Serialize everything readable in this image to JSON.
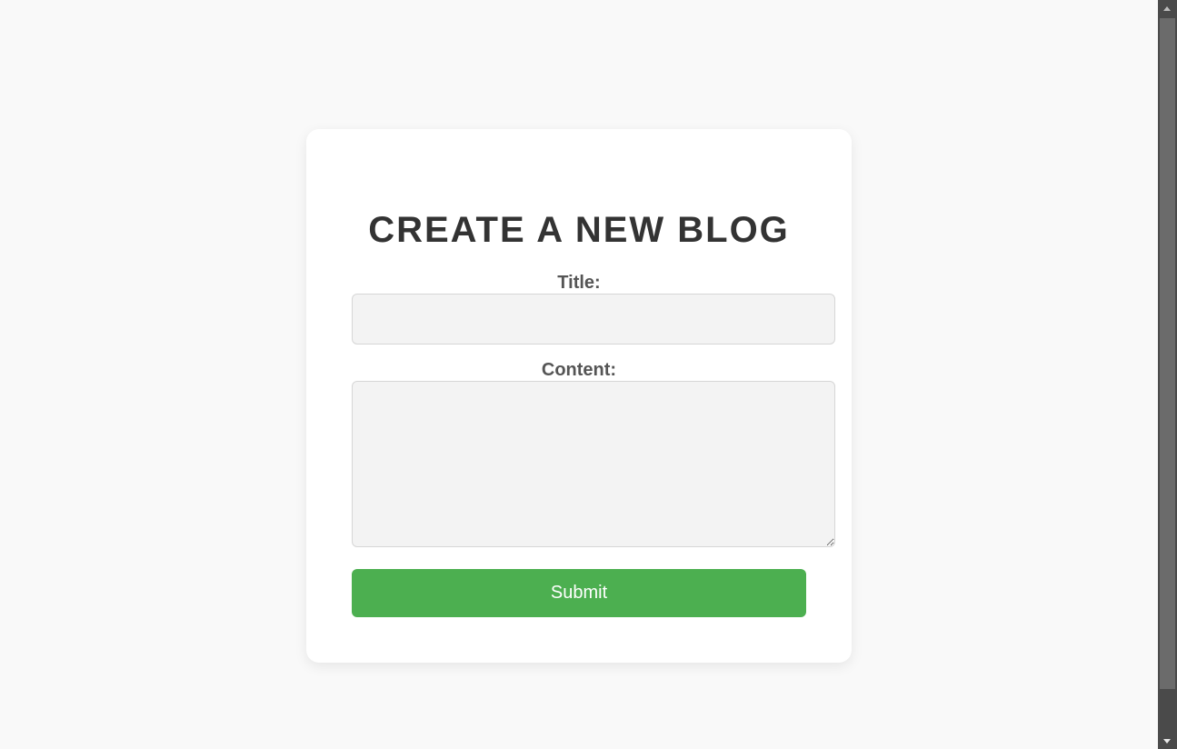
{
  "form": {
    "heading": "CREATE A NEW BLOG",
    "title_label": "Title:",
    "title_value": "",
    "content_label": "Content:",
    "content_value": "",
    "submit_label": "Submit"
  },
  "colors": {
    "background": "#f9f9f9",
    "card": "#ffffff",
    "heading": "#333333",
    "label": "#555555",
    "field_background": "#f3f3f3",
    "submit_background": "#4caf50",
    "submit_text": "#ffffff"
  },
  "scrollbar": {
    "up_icon": "arrow-up-icon",
    "down_icon": "arrow-down-icon"
  }
}
